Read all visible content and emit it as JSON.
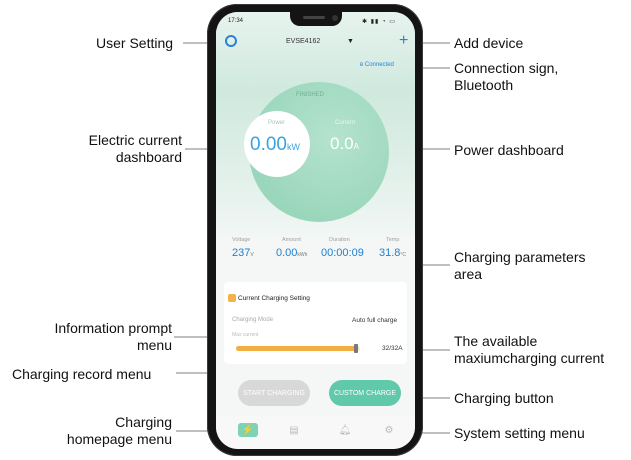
{
  "phone": {
    "status_time": "17:34",
    "header_title": "EVSE4162",
    "connection_text": "Connected",
    "state_text": "FINISHED",
    "power": {
      "label": "Power",
      "value": "0.00",
      "unit": "kW"
    },
    "current": {
      "label": "Current",
      "value": "0.0",
      "unit": "A"
    },
    "params": [
      {
        "label": "Voltage",
        "value": "237",
        "unit": "V"
      },
      {
        "label": "Amount",
        "value": "0.00",
        "unit": "kWh"
      },
      {
        "label": "Duration",
        "value": "00:00:09",
        "unit": ""
      },
      {
        "label": "Temp",
        "value": "31.8",
        "unit": "°C"
      }
    ],
    "card_title": "Current Charging Setting",
    "mode_label": "Charging Mode",
    "mode_value": "Auto full charge",
    "max_label": "Max current",
    "max_value": "32/32A",
    "max_fraction": 0.97,
    "btn_start": "START CHARGING",
    "btn_custom": "CUSTOM CHARGE"
  },
  "callouts": {
    "user_setting": "User Setting",
    "electric_current_1": "Electric current",
    "electric_current_2": "dashboard",
    "info_prompt_1": "Information prompt",
    "info_prompt_2": "menu",
    "charging_record": "Charging record menu",
    "charging_home_1": "Charging",
    "charging_home_2": "homepage menu",
    "add_device": "Add device",
    "connection_1": "Connection sign,",
    "connection_2": "Bluetooth",
    "power_dashboard": "Power dashboard",
    "params_area_1": "Charging parameters",
    "params_area_2": "area",
    "available_1": "The available",
    "available_2": "maxiumcharging current",
    "charging_button": "Charging button",
    "system_setting": "System setting menu"
  },
  "colors": {
    "accent_blue": "#2b82d6",
    "green": "#5fc9a9",
    "orange": "#f0ae43"
  }
}
